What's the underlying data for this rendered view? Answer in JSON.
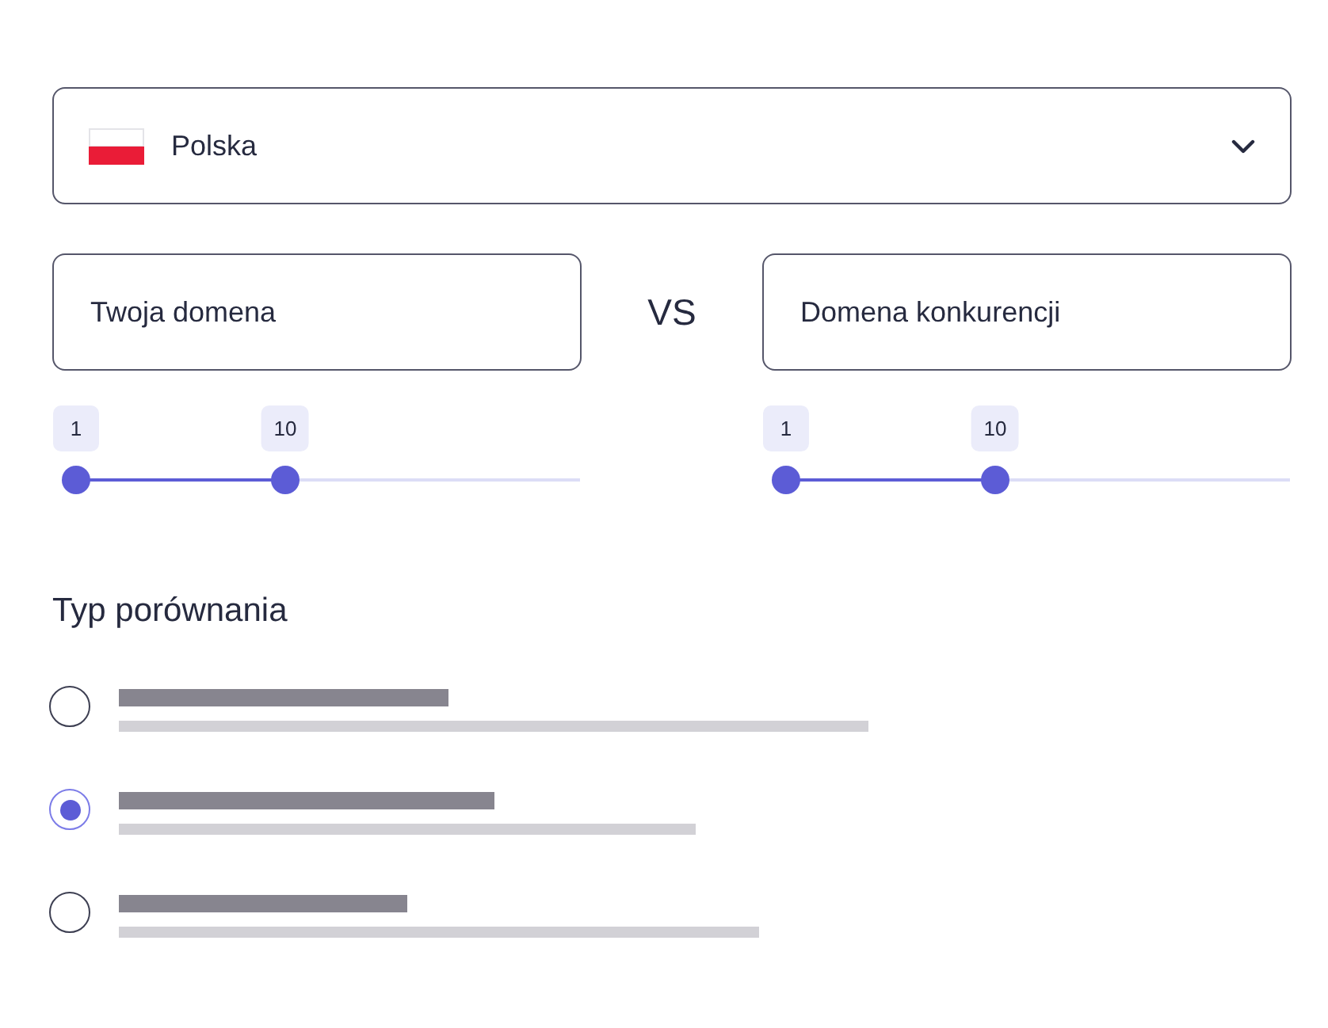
{
  "country_select": {
    "value": "Polska"
  },
  "domain_fields": [
    {
      "placeholder": "Twoja domena",
      "range_slider": {
        "thumbs": [
          {
            "label": "1",
            "level": 0
          },
          {
            "label": "10",
            "level": 0.415
          }
        ]
      }
    },
    {
      "placeholder": "Domena konkurencji",
      "range_slider": {
        "thumbs": [
          {
            "label": "1",
            "level": 0
          },
          {
            "label": "10",
            "level": 0.415
          }
        ]
      }
    }
  ],
  "versus_label": "VS",
  "comparison_type": {
    "heading": "Typ porównania",
    "options": [
      {
        "selected": false
      },
      {
        "selected": true
      },
      {
        "selected": false
      }
    ]
  }
}
